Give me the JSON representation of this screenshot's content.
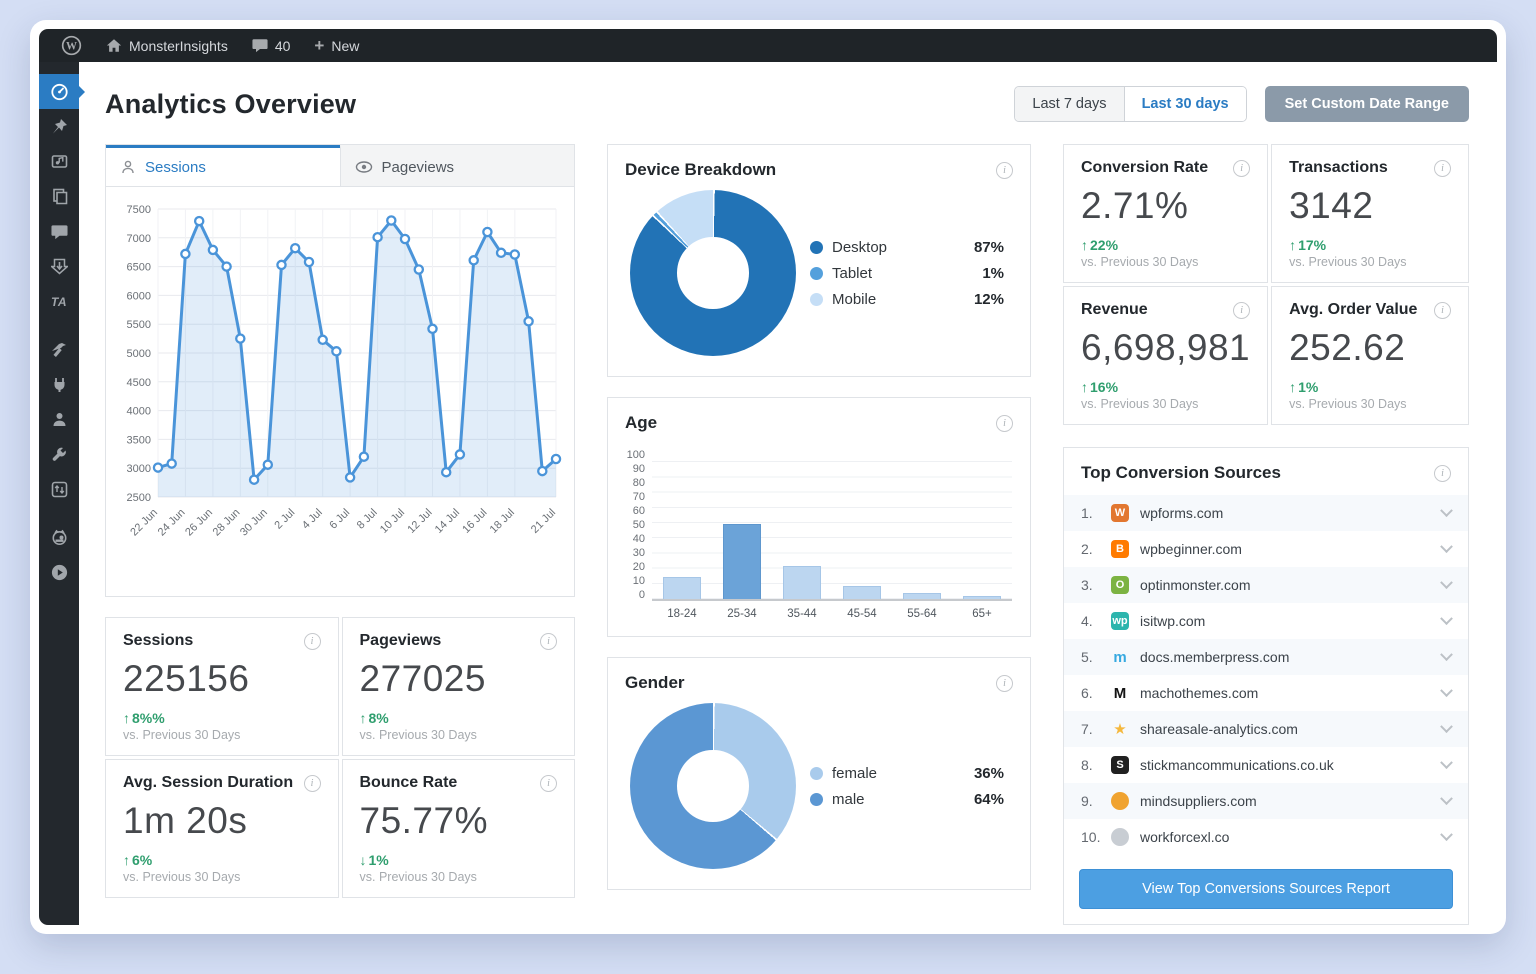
{
  "admin_bar": {
    "site_name": "MonsterInsights",
    "comments_count": "40",
    "new_label": "New"
  },
  "sidebar": {
    "active": "dashboard",
    "icons": [
      "dashboard",
      "pin",
      "media",
      "pages",
      "comments",
      "updates",
      "text-ta",
      "tools",
      "plugins",
      "users",
      "wrench",
      "settings",
      "monsterinsights",
      "video"
    ]
  },
  "header": {
    "title": "Analytics Overview",
    "range_last7": "Last 7 days",
    "range_last30": "Last 30 days",
    "custom_range": "Set Custom Date Range"
  },
  "tabs": {
    "sessions": "Sessions",
    "pageviews": "Pageviews"
  },
  "chart_data": [
    {
      "id": "sessions_trend",
      "type": "line",
      "title": "Sessions",
      "ylim": [
        2500,
        7500
      ],
      "y_tick_step": 500,
      "tick_labels": [
        "22 Jun",
        "24 Jun",
        "26 Jun",
        "28 Jun",
        "30 Jun",
        "2 Jul",
        "4 Jul",
        "6 Jul",
        "8 Jul",
        "10 Jul",
        "12 Jul",
        "14 Jul",
        "16 Jul",
        "18 Jul",
        "21 Jul"
      ],
      "values": [
        3010,
        3080,
        6720,
        7290,
        6790,
        6500,
        5250,
        2800,
        3060,
        6530,
        6820,
        6580,
        5230,
        5030,
        2840,
        3200,
        7010,
        7300,
        6980,
        6450,
        5420,
        2930,
        3240,
        6610,
        7100,
        6740,
        6710,
        5550,
        2950,
        3160
      ],
      "line_color": "#4a94d9",
      "fill_color": "rgba(78,150,217,0.17)",
      "grid": true,
      "legend_position": "none"
    },
    {
      "id": "device_breakdown",
      "type": "pie",
      "title": "Device Breakdown",
      "labels": [
        "Desktop",
        "Tablet",
        "Mobile"
      ],
      "values": [
        87,
        1,
        12
      ],
      "display_values": [
        "87%",
        "1%",
        "12%"
      ],
      "colors": [
        "#2273b6",
        "#54a0dc",
        "#c5def6"
      ],
      "legend_position": "right"
    },
    {
      "id": "age",
      "type": "bar",
      "title": "Age",
      "categories": [
        "18-24",
        "25-34",
        "35-44",
        "45-54",
        "55-64",
        "65+"
      ],
      "values": [
        15,
        50,
        22,
        9,
        4,
        2
      ],
      "ylim": [
        0,
        100
      ],
      "y_tick_step": 10,
      "bar_color": "#bcd6f0",
      "highlight_index": 1,
      "highlight_color": "#6ba3d8",
      "grid": true
    },
    {
      "id": "gender",
      "type": "pie",
      "title": "Gender",
      "labels": [
        "female",
        "male"
      ],
      "values": [
        36,
        64
      ],
      "display_values": [
        "36%",
        "64%"
      ],
      "colors": [
        "#a9cbec",
        "#5b97d3"
      ],
      "legend_position": "right"
    }
  ],
  "metrics": {
    "cards": [
      {
        "title": "Sessions",
        "value": "225156",
        "delta": "8%%",
        "dir": "up",
        "note": "vs. Previous 30 Days"
      },
      {
        "title": "Pageviews",
        "value": "277025",
        "delta": "8%",
        "dir": "up",
        "note": "vs. Previous 30 Days"
      },
      {
        "title": "Avg. Session Duration",
        "value": "1m 20s",
        "delta": "6%",
        "dir": "up",
        "note": "vs. Previous 30 Days"
      },
      {
        "title": "Bounce Rate",
        "value": "75.77%",
        "delta": "1%",
        "dir": "down",
        "note": "vs. Previous 30 Days"
      }
    ]
  },
  "stats": {
    "cards": [
      {
        "title": "Conversion Rate",
        "value": "2.71%",
        "delta": "22%",
        "dir": "up",
        "note": "vs. Previous 30 Days"
      },
      {
        "title": "Transactions",
        "value": "3142",
        "delta": "17%",
        "dir": "up",
        "note": "vs. Previous 30 Days"
      },
      {
        "title": "Revenue",
        "value": "6,698,981",
        "delta": "16%",
        "dir": "up",
        "note": "vs. Previous 30 Days"
      },
      {
        "title": "Avg. Order Value",
        "value": "252.62",
        "delta": "1%",
        "dir": "up",
        "note": "vs. Previous 30 Days"
      }
    ]
  },
  "sources": {
    "title": "Top Conversion Sources",
    "button_label": "View Top Conversions Sources Report",
    "items": [
      {
        "rank": "1.",
        "domain": "wpforms.com",
        "icon": {
          "glyph": "W",
          "bg": "#e27730",
          "fg": "#ffffff",
          "round": false
        }
      },
      {
        "rank": "2.",
        "domain": "wpbeginner.com",
        "icon": {
          "glyph": "B",
          "bg": "#ff7b00",
          "fg": "#ffffff",
          "round": false
        }
      },
      {
        "rank": "3.",
        "domain": "optinmonster.com",
        "icon": {
          "glyph": "O",
          "bg": "#7cb342",
          "fg": "#ffffff",
          "round": false
        }
      },
      {
        "rank": "4.",
        "domain": "isitwp.com",
        "icon": {
          "glyph": "wp",
          "bg": "#2cb5ad",
          "fg": "#ffffff",
          "round": false
        }
      },
      {
        "rank": "5.",
        "domain": "docs.memberpress.com",
        "icon": {
          "glyph": "m",
          "bg": "transparent",
          "fg": "#36a9e0",
          "round": false
        }
      },
      {
        "rank": "6.",
        "domain": "machothemes.com",
        "icon": {
          "glyph": "M",
          "bg": "transparent",
          "fg": "#141414",
          "round": false
        }
      },
      {
        "rank": "7.",
        "domain": "shareasale-analytics.com",
        "icon": {
          "glyph": "★",
          "bg": "transparent",
          "fg": "#f5b83d",
          "round": false
        }
      },
      {
        "rank": "8.",
        "domain": "stickmancommunications.co.uk",
        "icon": {
          "glyph": "S",
          "bg": "#202020",
          "fg": "#ffffff",
          "round": false
        }
      },
      {
        "rank": "9.",
        "domain": "mindsuppliers.com",
        "icon": {
          "glyph": "",
          "bg": "#f0a330",
          "fg": "#ffffff",
          "round": true
        }
      },
      {
        "rank": "10.",
        "domain": "workforcexl.co",
        "icon": {
          "glyph": "",
          "bg": "#c8cdd3",
          "fg": "#ffffff",
          "round": true
        }
      }
    ]
  },
  "icons_glyphs": {
    "up_arrow": "↑",
    "down_arrow": "↓",
    "info": "i",
    "plus": "+"
  },
  "colors": {
    "accent_blue": "#2b7cc3",
    "wp_admin_bar": "#1f2428",
    "wp_sidebar": "#23282d",
    "green": "#2f9e6e",
    "button_blue": "#4c9fe2",
    "slate_button": "#8b9aa9"
  }
}
